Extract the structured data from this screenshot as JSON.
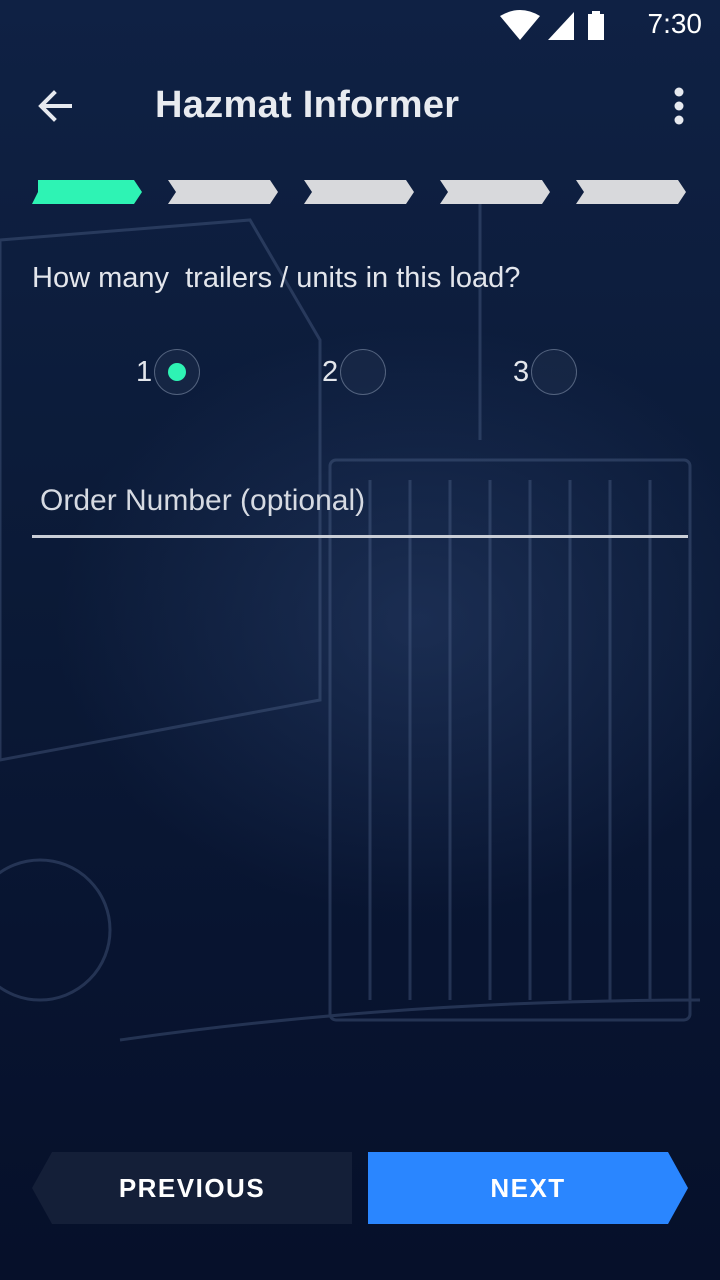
{
  "status_bar": {
    "time": "7:30",
    "icons": [
      "wifi-icon",
      "cellular-signal-icon",
      "battery-icon"
    ]
  },
  "app_bar": {
    "title": "Hazmat Informer",
    "back_icon": "arrow-back-icon",
    "menu_icon": "more-vert-icon"
  },
  "progress": {
    "total_steps": 5,
    "current_step": 1,
    "active_color": "#2ef3b4",
    "inactive_color": "#d8d9dc"
  },
  "question": {
    "text": "How many  trailers / units in this load?"
  },
  "trailer_options": {
    "options": [
      {
        "label": "1",
        "selected": true
      },
      {
        "label": "2",
        "selected": false
      },
      {
        "label": "3",
        "selected": false
      }
    ]
  },
  "order_number": {
    "placeholder": "Order Number (optional)",
    "value": ""
  },
  "footer": {
    "previous_label": "PREVIOUS",
    "next_label": "NEXT",
    "next_color": "#2a86ff",
    "previous_color": "#141f38"
  }
}
